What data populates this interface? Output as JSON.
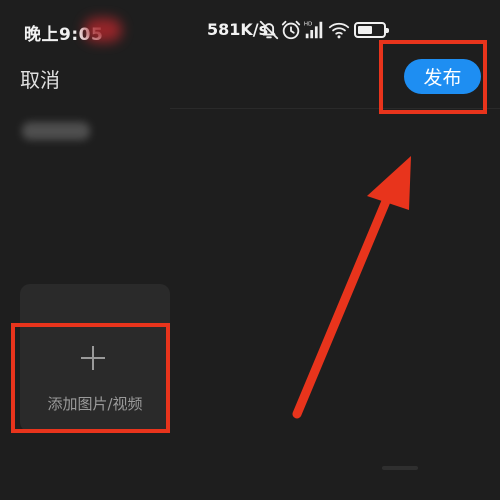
{
  "status_bar": {
    "time": "晚上9:05",
    "net_speed": "581K/s",
    "icons": [
      "bell-off-icon",
      "alarm-clock-icon",
      "hd-signal-icon",
      "wifi-icon",
      "battery-icon"
    ]
  },
  "header": {
    "cancel_label": "取消",
    "publish_label": "发布"
  },
  "media": {
    "add_label": "添加图片/视频"
  },
  "colors": {
    "background": "#1e1e1e",
    "accent": "#1e8ef2",
    "annotation": "#e8341c",
    "card": "#2a2a2a"
  }
}
